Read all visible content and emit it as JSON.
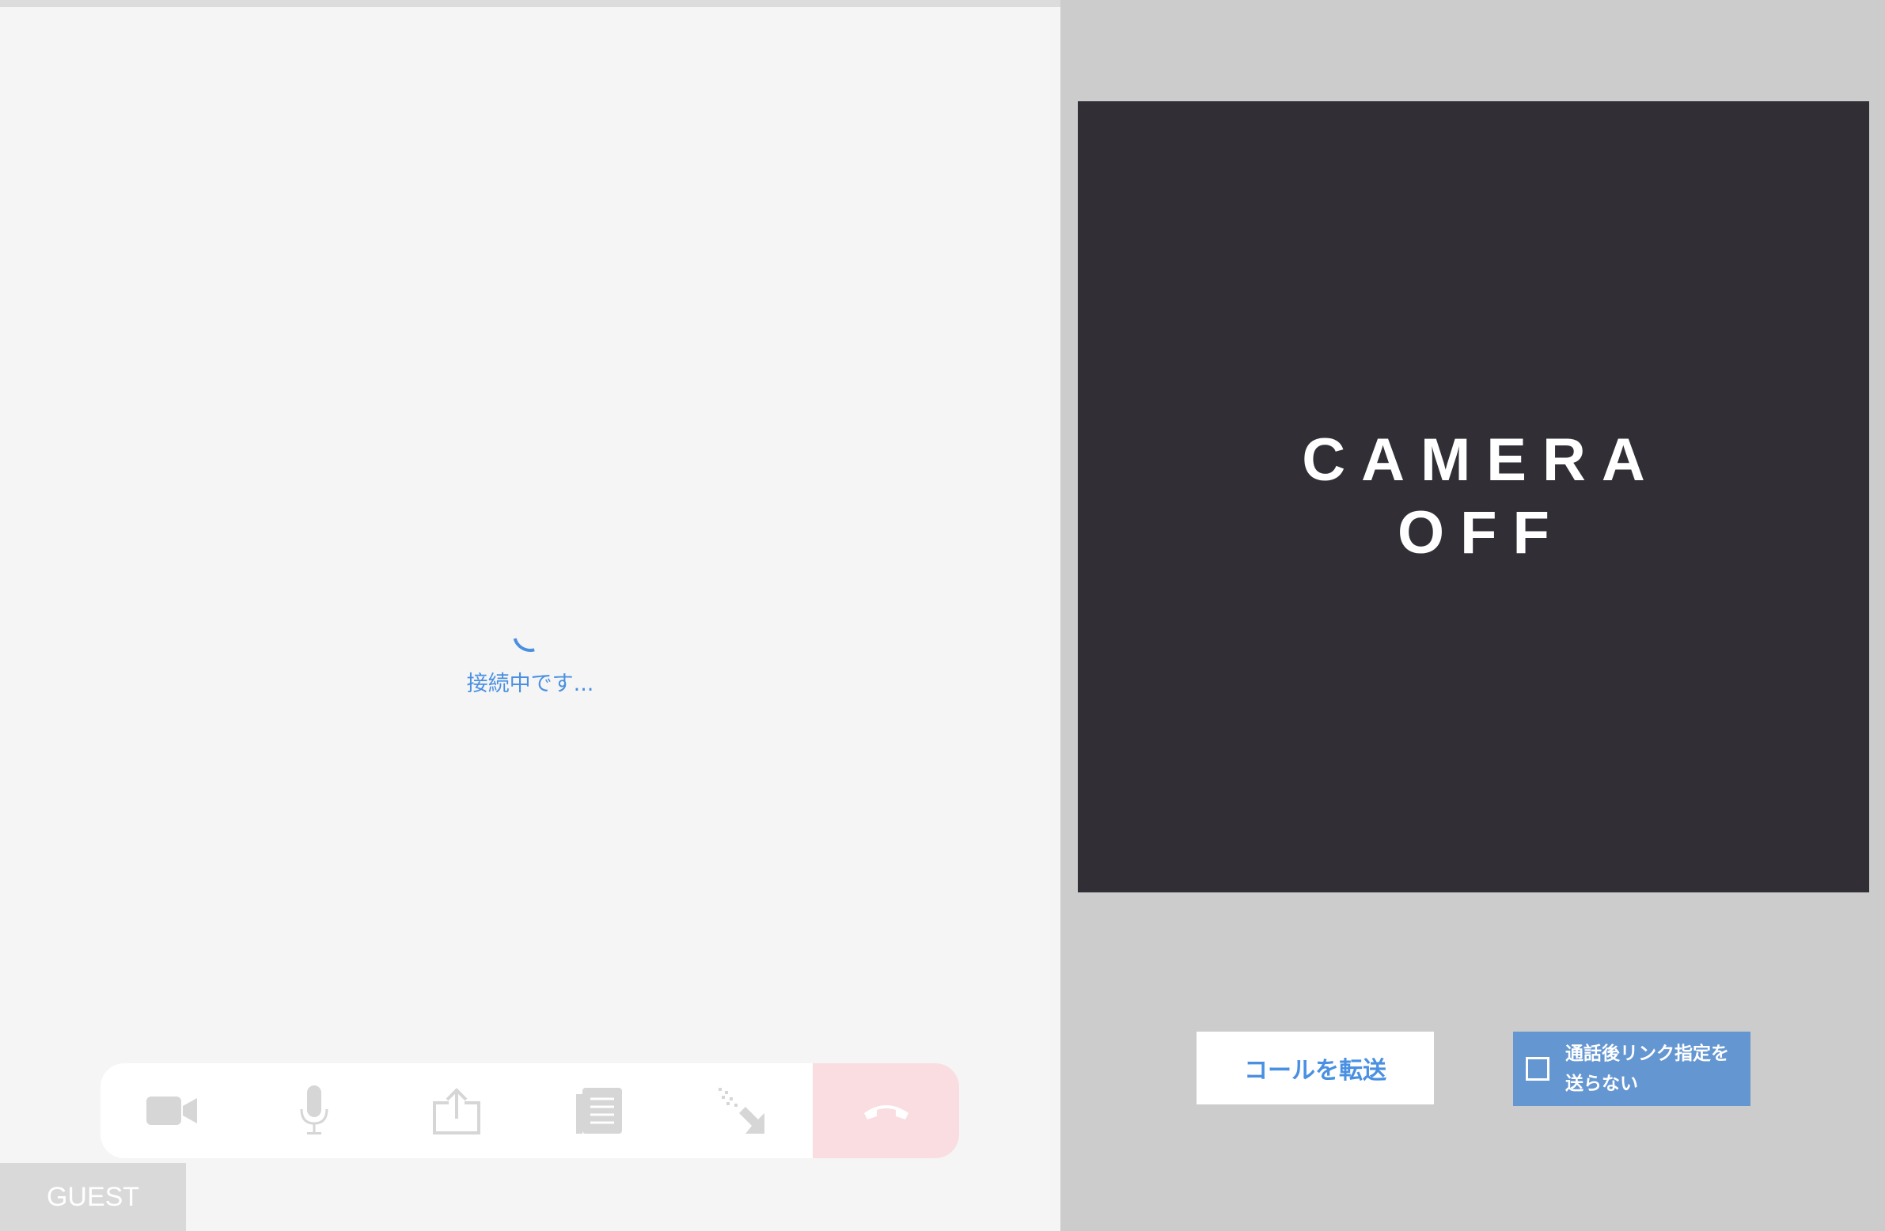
{
  "left": {
    "loading_text": "接続中です...",
    "guest_label": "GUEST",
    "toolbar": [
      {
        "name": "camera-icon",
        "color": "#d6d6d6"
      },
      {
        "name": "microphone-icon",
        "color": "#d6d6d6"
      },
      {
        "name": "share-icon",
        "color": "#d6d6d6"
      },
      {
        "name": "document-icon",
        "color": "#d6d6d6"
      },
      {
        "name": "pointer-icon",
        "color": "#d6d6d6"
      },
      {
        "name": "hangup-icon",
        "color": "#ffffff"
      }
    ]
  },
  "right": {
    "camera_line1": "CAMERA",
    "camera_line2": "OFF",
    "transfer_button": "コールを転送",
    "noreply_line1": "通話後リンク指定を",
    "noreply_line2": "送らない"
  },
  "colors": {
    "accent": "#4a90e2",
    "hangup_bg": "#fadde1",
    "video_bg": "#312e35",
    "checkbox_panel": "#6496d2"
  }
}
